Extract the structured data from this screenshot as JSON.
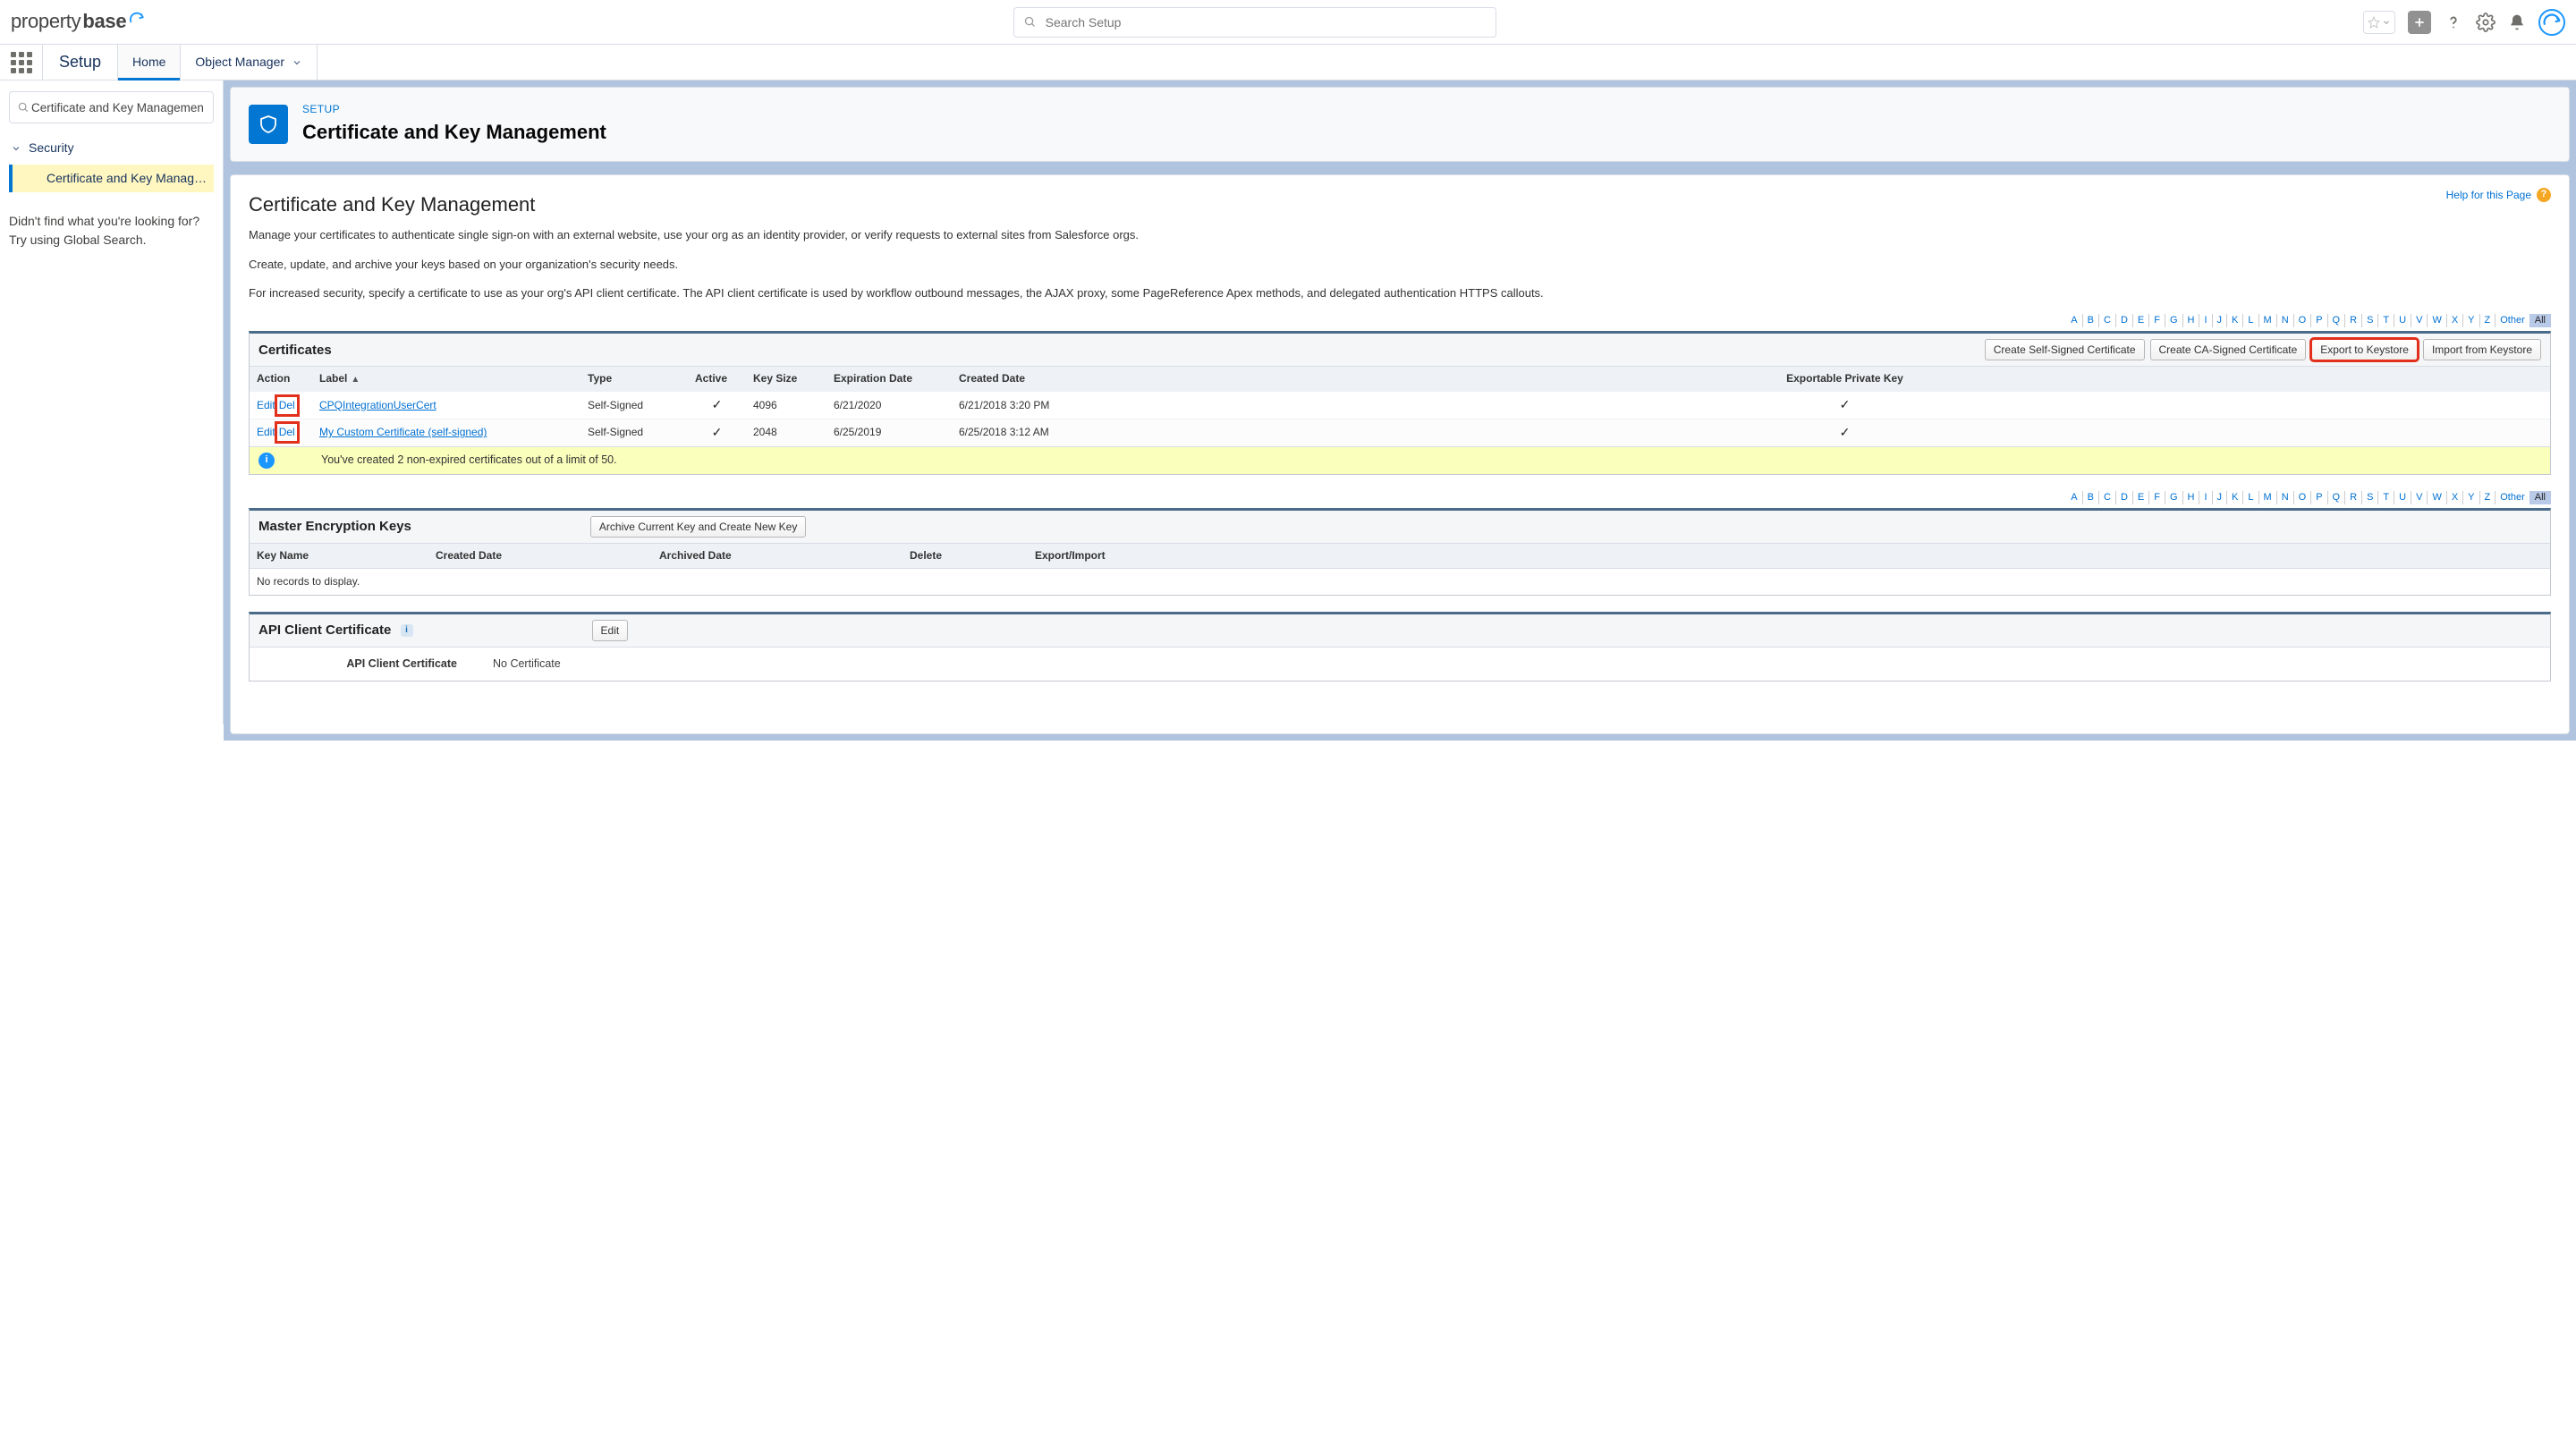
{
  "brand": {
    "part1": "property",
    "part2": "base"
  },
  "search": {
    "placeholder": "Search Setup"
  },
  "nav": {
    "app_name": "Setup",
    "tabs": [
      {
        "label": "Home",
        "active": true
      },
      {
        "label": "Object Manager",
        "chevron": true
      }
    ]
  },
  "sidebar": {
    "search_value": "Certificate and Key Management",
    "tree_parent": "Security",
    "tree_child": "Certificate and Key Managem...",
    "help_line1": "Didn't find what you're looking for?",
    "help_line2": "Try using Global Search."
  },
  "page_header": {
    "crumb": "SETUP",
    "title": "Certificate and Key Management"
  },
  "content": {
    "heading": "Certificate and Key Management",
    "help_link": "Help for this Page",
    "desc1": "Manage your certificates to authenticate single sign-on with an external website, use your org as an identity provider, or verify requests to external sites from Salesforce orgs.",
    "desc2": "Create, update, and archive your keys based on your organization's security needs.",
    "desc3": "For increased security, specify a certificate to use as your org's API client certificate. The API client certificate is used by workflow outbound messages, the AJAX proxy, some PageReference Apex methods, and delegated authentication HTTPS callouts."
  },
  "alpha": {
    "letters": [
      "A",
      "B",
      "C",
      "D",
      "E",
      "F",
      "G",
      "H",
      "I",
      "J",
      "K",
      "L",
      "M",
      "N",
      "O",
      "P",
      "Q",
      "R",
      "S",
      "T",
      "U",
      "V",
      "W",
      "X",
      "Y",
      "Z"
    ],
    "other": "Other",
    "all": "All"
  },
  "cert_panel": {
    "title": "Certificates",
    "buttons": {
      "self_signed": "Create Self-Signed Certificate",
      "ca_signed": "Create CA-Signed Certificate",
      "export": "Export to Keystore",
      "import": "Import from Keystore"
    },
    "columns": {
      "action": "Action",
      "label": "Label",
      "type": "Type",
      "active": "Active",
      "key_size": "Key Size",
      "expiration": "Expiration Date",
      "created": "Created Date",
      "exportable": "Exportable Private Key"
    },
    "edit": "Edit",
    "del": "Del",
    "rows": [
      {
        "label": "CPQIntegrationUserCert",
        "type": "Self-Signed",
        "active": true,
        "key_size": "4096",
        "expiration": "6/21/2020",
        "created": "6/21/2018 3:20 PM",
        "exportable": true
      },
      {
        "label": "My Custom Certificate (self-signed)",
        "type": "Self-Signed",
        "active": true,
        "key_size": "2048",
        "expiration": "6/25/2019",
        "created": "6/25/2018 3:12 AM",
        "exportable": true
      }
    ],
    "info": "You've created 2 non-expired certificates out of a limit of 50."
  },
  "keys_panel": {
    "title": "Master Encryption Keys",
    "button": "Archive Current Key and Create New Key",
    "columns": {
      "name": "Key Name",
      "created": "Created Date",
      "archived": "Archived Date",
      "delete": "Delete",
      "export": "Export/Import"
    },
    "empty": "No records to display."
  },
  "api_panel": {
    "title": "API Client Certificate",
    "button": "Edit",
    "label": "API Client Certificate",
    "value": "No Certificate"
  }
}
